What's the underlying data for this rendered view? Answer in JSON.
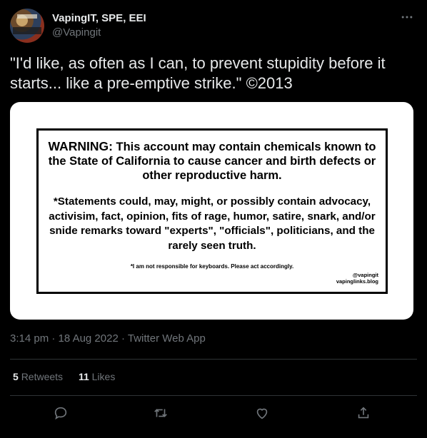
{
  "author": {
    "display_name": "VapingIT, SPE, EEI",
    "handle": "@Vapingit"
  },
  "more_icon": "more-options-icon",
  "tweet": {
    "text": "\"I'd like, as often as I can, to prevent stupidity before it starts... like a pre-emptive strike.\" ©2013"
  },
  "image_card": {
    "warning_label": "WARNING:",
    "warning_text": "This account may contain chemicals known to the State of California to cause cancer and birth defects or other reproductive harm.",
    "statements_text": "*Statements could, may, might, or possibly contain advocacy, activisim, fact, opinion, fits of rage, humor, satire, snark, and/or snide remarks toward \"experts\", \"officials\", politicians, and the rarely seen truth.",
    "footnote": "*I am not responsible for keyboards. Please act accordingly.",
    "credit_handle": "@vapingit",
    "credit_site": "vapinglinks.blog"
  },
  "meta": {
    "time": "3:14 pm",
    "separator": "·",
    "date": "18 Aug 2022",
    "source": "Twitter Web App"
  },
  "stats": {
    "retweets_count": "5",
    "retweets_label": "Retweets",
    "likes_count": "11",
    "likes_label": "Likes"
  },
  "actions": [
    "reply-icon",
    "retweet-icon",
    "like-icon",
    "share-icon"
  ]
}
